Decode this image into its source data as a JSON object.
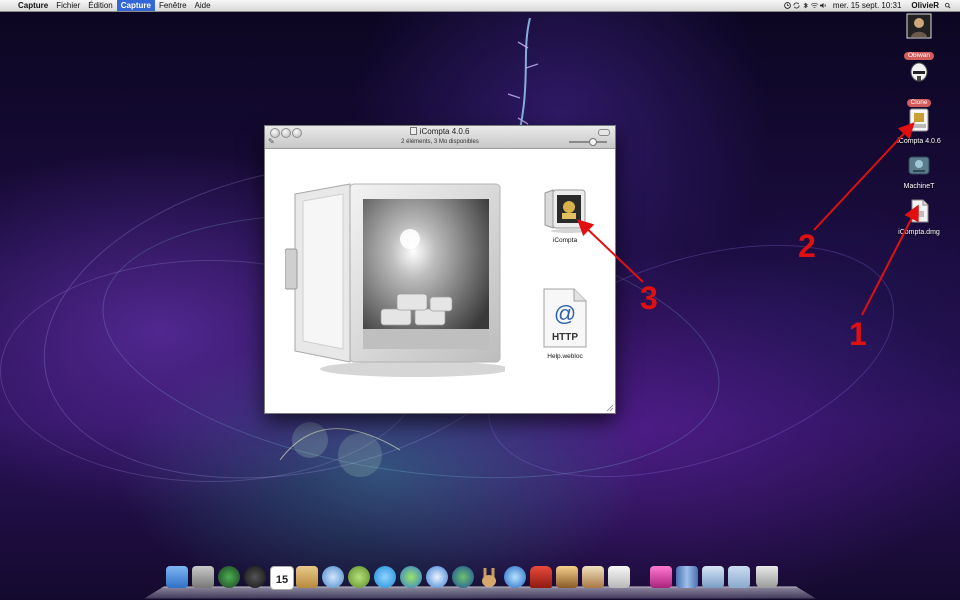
{
  "menubar": {
    "apple_glyph": "",
    "app_name": "Capture",
    "menus": [
      "Fichier",
      "Édition",
      "Capture",
      "Fenêtre",
      "Aide"
    ],
    "active_menu_index": 2,
    "clock": "mer. 15 sept.  10:31",
    "user": "OlivieR",
    "status_icons": [
      "timemachine-icon",
      "sync-icon",
      "bluetooth-icon",
      "wifi-icon",
      "volume-icon"
    ]
  },
  "desktop_icons": [
    {
      "name": "Obiwan",
      "icon": "obiwan-avatar-icon",
      "tagged": true
    },
    {
      "name": "Clone",
      "icon": "clone-trooper-icon",
      "tagged": true
    },
    {
      "name": "iCompta 4.0.6",
      "icon": "mounted-disk-icon",
      "tagged": false
    },
    {
      "name": "MachineT",
      "icon": "external-drive-icon",
      "tagged": false
    },
    {
      "name": "iCompta.dmg",
      "icon": "dmg-file-icon",
      "tagged": false
    }
  ],
  "window": {
    "title": "iCompta 4.0.6",
    "status": "2 éléments, 3 Mo disponibles",
    "items": [
      {
        "label": "iCompta",
        "icon": "safe-app-icon"
      },
      {
        "label": "Help.webloc",
        "icon": "webloc-http-icon",
        "icon_text": "HTTP",
        "icon_symbol": "@"
      }
    ]
  },
  "annotations": [
    "1",
    "2",
    "3"
  ],
  "annotation_color": "#e01010",
  "dock": {
    "apps": [
      "finder-icon",
      "system-preferences-icon",
      "time-machine-icon",
      "activity-icon",
      "ical-icon",
      "address-book-icon",
      "mail-icon",
      "adium-icon",
      "skype-icon",
      "ichat-icon",
      "safari-icon",
      "google-earth-icon",
      "rabbit-icon",
      "itunes-icon",
      "chair-icon",
      "iphoto-icon",
      "guitar-icon",
      "preview-icon",
      "flower-app-icon",
      "books-icon",
      "mail-folder-icon",
      "folder-icon",
      "trash-icon"
    ],
    "ical_day": "15"
  }
}
